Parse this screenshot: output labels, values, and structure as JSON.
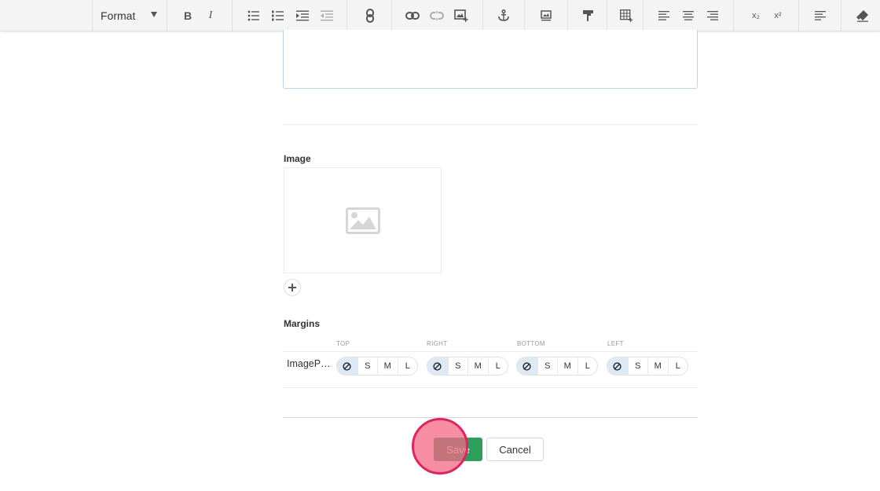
{
  "toolbar": {
    "format_label": "Format",
    "bold": "B",
    "italic": "I",
    "subscript": "x₂",
    "superscript": "x²"
  },
  "image_section": {
    "label": "Image"
  },
  "margins": {
    "label": "Margins",
    "columns": [
      "TOP",
      "RIGHT",
      "BOTTOM",
      "LEFT"
    ],
    "row_title": "ImageP…",
    "options": [
      "S",
      "M",
      "L"
    ]
  },
  "actions": {
    "save_label": "Save",
    "cancel_label": "Cancel"
  },
  "colors": {
    "save_bg": "#2e9e5b",
    "active_segment": "#dde9f5",
    "click_marker": "#e0245e"
  }
}
